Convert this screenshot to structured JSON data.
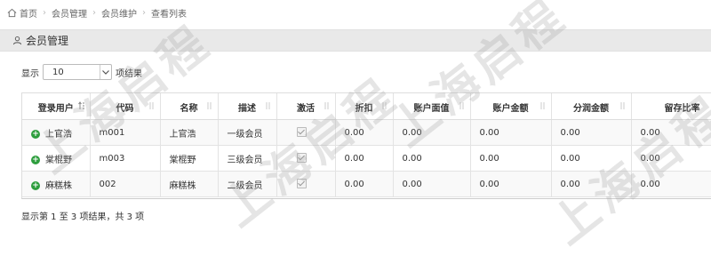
{
  "breadcrumb": {
    "items": [
      "首页",
      "会员管理",
      "会员维护",
      "查看列表"
    ],
    "separator": "›"
  },
  "panel": {
    "title": "会员管理"
  },
  "length": {
    "prefix": "显示",
    "value": "10",
    "suffix": "项结果"
  },
  "table": {
    "headers": [
      "登录用户",
      "代码",
      "名称",
      "描述",
      "激活",
      "折扣",
      "账户面值",
      "账户金额",
      "分润金额",
      "留存比率"
    ],
    "rows": [
      {
        "login": "上官浩",
        "code": "m001",
        "name": "上官浩",
        "desc": "一级会员",
        "active": true,
        "discount": "0.00",
        "face": "0.00",
        "balance": "0.00",
        "profit": "0.00",
        "retain": "0.00"
      },
      {
        "login": "棠棍野",
        "code": "m003",
        "name": "棠棍野",
        "desc": "三级会员",
        "active": true,
        "discount": "0.00",
        "face": "0.00",
        "balance": "0.00",
        "profit": "0.00",
        "retain": "0.00"
      },
      {
        "login": "麻糕株",
        "code": "002",
        "name": "麻糕株",
        "desc": "二级会员",
        "active": true,
        "discount": "0.00",
        "face": "0.00",
        "balance": "0.00",
        "profit": "0.00",
        "retain": "0.00"
      }
    ]
  },
  "info": {
    "text": "显示第 1 至 3 项结果，共 3 项"
  },
  "colors": {
    "plus": "#2e9e3e",
    "header_bg": "#e9e9e9"
  },
  "watermark": {
    "text": "上海启程"
  }
}
